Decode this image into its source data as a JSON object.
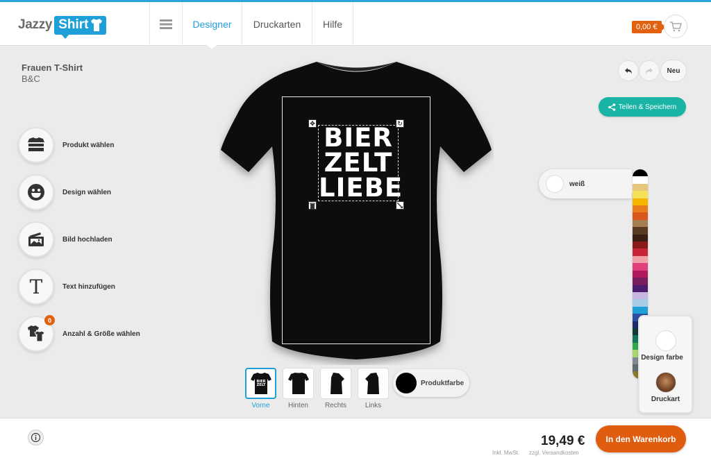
{
  "brand": {
    "logo_part1": "Jazzy",
    "logo_part2": "Shirt",
    "accent": "#1e9fd8"
  },
  "nav": {
    "menu_icon": "hamburger-icon",
    "items": [
      {
        "label": "Designer",
        "active": true
      },
      {
        "label": "Druckarten",
        "active": false
      },
      {
        "label": "Hilfe",
        "active": false
      }
    ]
  },
  "cart": {
    "price": "0,00 €",
    "icon": "shopping-cart-icon"
  },
  "product": {
    "title": "Frauen T-Shirt",
    "brand": "B&C"
  },
  "tools": [
    {
      "label": "Produkt wählen",
      "icon": "shirt-stack-icon"
    },
    {
      "label": "Design wählen",
      "icon": "smiley-icon"
    },
    {
      "label": "Bild hochladen",
      "icon": "image-upload-icon"
    },
    {
      "label": "Text hinzufügen",
      "icon": "text-icon",
      "glyph": "T"
    },
    {
      "label": "Anzahl & Größe wählen",
      "icon": "shirts-size-icon",
      "badge": "0"
    }
  ],
  "design": {
    "lines": [
      "BIER",
      "ZELT",
      "LIEBE"
    ],
    "shirt_color": "#111111",
    "text_color": "#ffffff"
  },
  "views": [
    {
      "label": "Vorne",
      "active": true
    },
    {
      "label": "Hinten",
      "active": false
    },
    {
      "label": "Rechts",
      "active": false
    },
    {
      "label": "Links",
      "active": false
    }
  ],
  "produktfarbe": {
    "label": "Produktfarbe",
    "color": "#000000"
  },
  "actions": {
    "undo_icon": "undo-icon",
    "redo_icon": "redo-icon",
    "new_label": "Neu",
    "share_label": "Teilen & Speichern",
    "share_color": "#19b4a5"
  },
  "color_picker": {
    "selected_label": "weiß",
    "selected_color": "#ffffff",
    "swatches": [
      "#000000",
      "#ffffff",
      "#e8c77a",
      "#f5e15a",
      "#f4b400",
      "#e87d1e",
      "#d9571a",
      "#a67c52",
      "#5a3a22",
      "#3c1f14",
      "#8b1a1a",
      "#c7243a",
      "#f2a0a8",
      "#e0407a",
      "#b0195c",
      "#7a1d5f",
      "#4b1d6e",
      "#c7b7e0",
      "#a6cde8",
      "#1e9fd8",
      "#2b4fa2",
      "#1c2a6e",
      "#0f3a3a",
      "#12755a",
      "#2faa4a",
      "#a8d86b",
      "#7d8a93",
      "#5d6b73",
      "#8a7a2a"
    ]
  },
  "color_panel": {
    "design_label": "Design farbe",
    "druckart_label": "Druckart"
  },
  "footer": {
    "info_icon": "info-icon",
    "price": "19,49 €",
    "note1": "Inkl. MwSt.",
    "note2": "zzgl. Versandkosten",
    "cta": "In den Warenkorb",
    "cta_color": "#e05d10"
  }
}
